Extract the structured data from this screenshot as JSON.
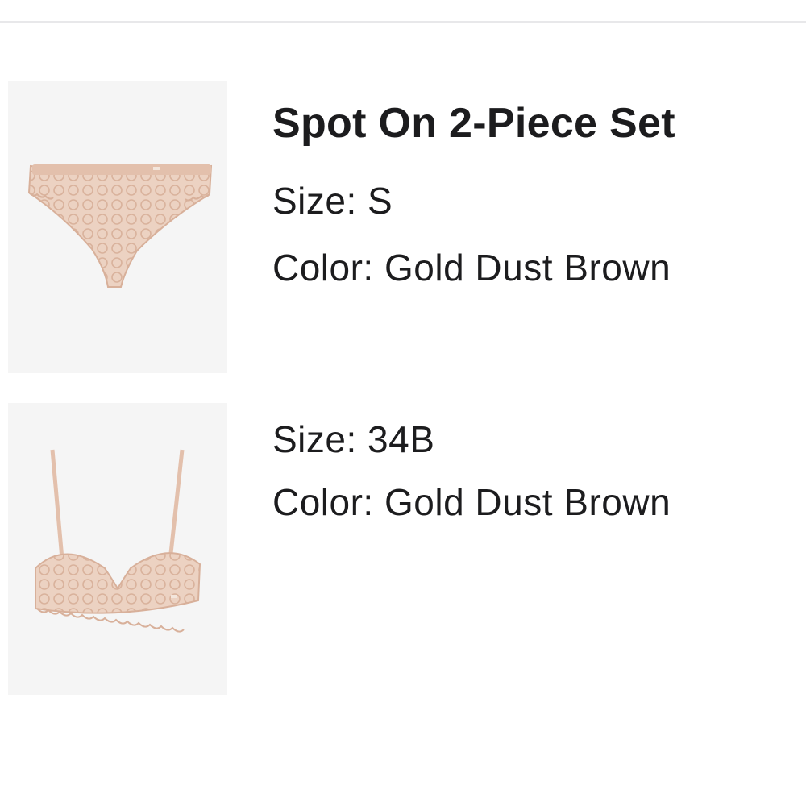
{
  "items": [
    {
      "title": "Spot On 2-Piece Set",
      "size": "Size: S",
      "color": "Color: Gold Dust Brown",
      "image": "lace-panty-image"
    },
    {
      "size": "Size: 34B",
      "color": "Color: Gold Dust Brown",
      "image": "lace-bra-image"
    }
  ],
  "colors": {
    "product": "#e9c9b6",
    "product_shade": "#d8b09a",
    "thumb_bg": "#f5f5f5",
    "text": "#1c1c1e"
  }
}
